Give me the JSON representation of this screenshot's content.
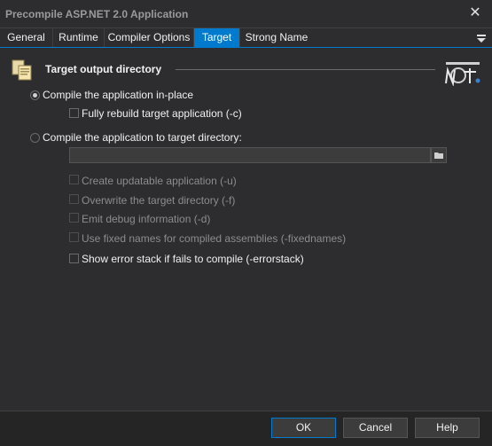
{
  "window": {
    "title": "Precompile ASP.NET 2.0 Application",
    "close_glyph": "✕"
  },
  "tabs": [
    {
      "label": "General"
    },
    {
      "label": "Runtime"
    },
    {
      "label": "Compiler Options"
    },
    {
      "label": "Target",
      "active": true
    },
    {
      "label": "Strong Name"
    }
  ],
  "section": {
    "title": "Target output directory",
    "icon": "copy-files-icon",
    "logo": "dotnet-logo"
  },
  "options": {
    "inplace_label": "Compile the application in-place",
    "inplace_checked": true,
    "rebuild_label": "Fully rebuild target application (-c)",
    "rebuild_checked": false,
    "target_label": "Compile the application to target directory:",
    "target_checked": false,
    "target_dir_value": "",
    "updatable_label": "Create updatable application (-u)",
    "overwrite_label": "Overwrite the target directory (-f)",
    "debug_label": "Emit debug information (-d)",
    "fixednames_label": "Use fixed names for compiled assemblies (-fixednames)",
    "errorstack_label": "Show error stack if fails to compile (-errorstack)",
    "errorstack_checked": false
  },
  "buttons": {
    "ok": "OK",
    "cancel": "Cancel",
    "help": "Help"
  },
  "colors": {
    "accent": "#007acc",
    "background": "#2d2d30",
    "disabled_text": "#8c8c8c"
  }
}
